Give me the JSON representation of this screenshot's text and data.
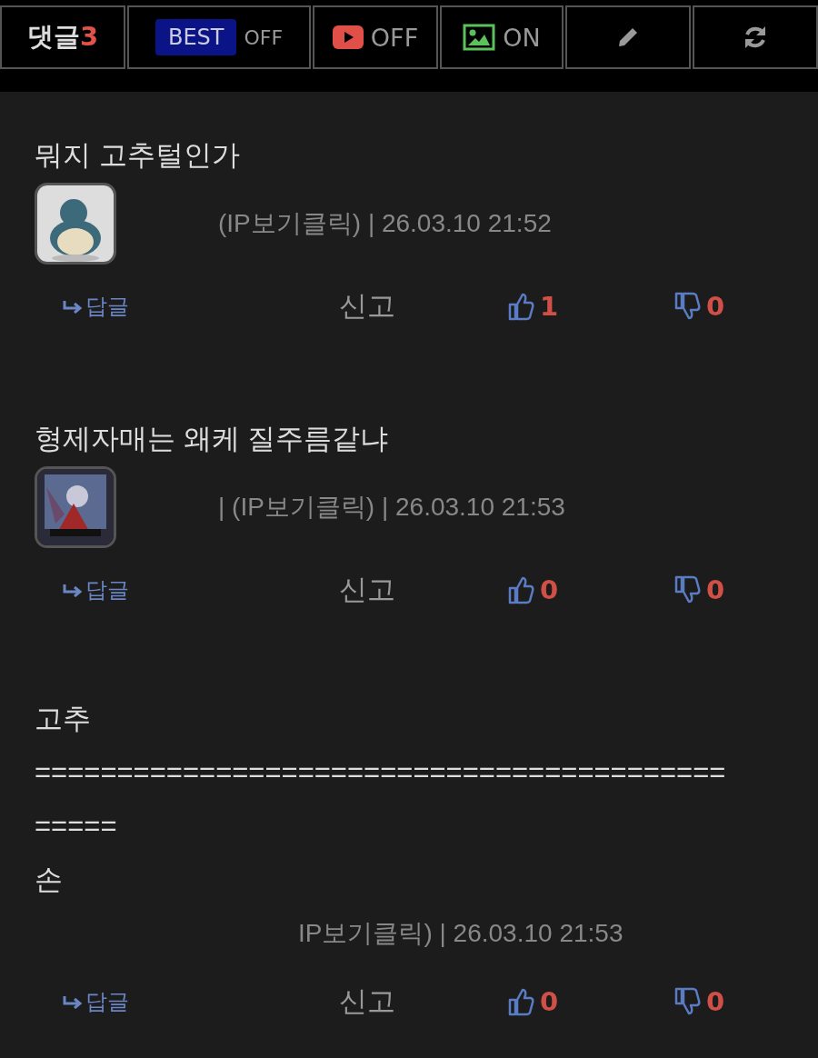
{
  "toolbar": {
    "comments_label": "댓글",
    "comments_count": "3",
    "best": {
      "label": "BEST",
      "state": "OFF",
      "on": false
    },
    "video": {
      "state": "OFF",
      "on": false
    },
    "image": {
      "state": "ON",
      "on": true
    }
  },
  "comments": [
    {
      "body": [
        "뭐지 고추털인가"
      ],
      "avatar": true,
      "meta": "(IP보기클릭) | 26.03.10 21:52",
      "reply": "답글",
      "report": "신고",
      "likes": "1",
      "dislikes": "0"
    },
    {
      "body": [
        "형제자매는 왜케 질주름같냐"
      ],
      "avatar": true,
      "meta": "| (IP보기클릭) | 26.03.10 21:53",
      "reply": "답글",
      "report": "신고",
      "likes": "0",
      "dislikes": "0"
    },
    {
      "body": [
        "고추",
        "==========================================",
        "=====",
        "손"
      ],
      "avatar": false,
      "meta": "IP보기클릭) | 26.03.10 21:53",
      "reply": "답글",
      "report": "신고",
      "likes": "0",
      "dislikes": "0"
    }
  ]
}
